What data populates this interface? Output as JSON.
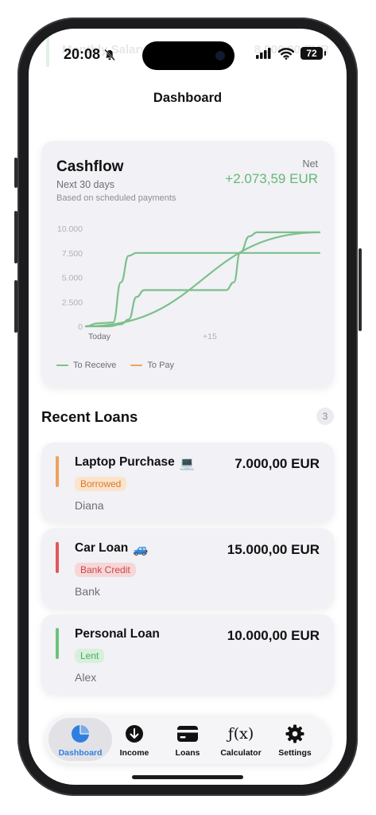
{
  "status_bar": {
    "time": "20:08",
    "battery": "72"
  },
  "ghost_header": {
    "label": "Monthly Salary",
    "amount": "8.000,00 EUR"
  },
  "nav": {
    "title": "Dashboard"
  },
  "cashflow": {
    "title": "Cashflow",
    "subtitle": "Next 30 days",
    "note": "Based on scheduled payments",
    "net_label": "Net",
    "net_value": "+2.073,59 EUR",
    "legend": {
      "receive": "To Receive",
      "pay": "To Pay"
    }
  },
  "chart_data": {
    "type": "line",
    "y_ticks": [
      "10.000",
      "7.500",
      "5.000",
      "2.500",
      "0"
    ],
    "x_ticks": [
      "Today",
      "+15"
    ],
    "ylim": [
      0,
      10000
    ],
    "xlim": [
      0,
      30
    ],
    "series": [
      {
        "name": "To Receive",
        "color": "#7cc08a",
        "x": [
          0,
          1.5,
          2.5,
          3.5,
          4.5,
          5.5,
          6.5,
          8,
          30
        ],
        "y": [
          0,
          300,
          350,
          400,
          4500,
          7200,
          7500,
          7500,
          7500
        ]
      },
      {
        "name": "To Receive",
        "color": "#7cc08a",
        "x": [
          0,
          3,
          4.5,
          5.5,
          6.5,
          7.5,
          15,
          18,
          19,
          19.8,
          21,
          22,
          23,
          30
        ],
        "y": [
          0,
          0,
          200,
          700,
          3000,
          3700,
          3700,
          3700,
          4500,
          7500,
          9200,
          9600,
          9600,
          9600
        ]
      },
      {
        "name": "To Receive",
        "color": "#7cc08a",
        "x": [
          0,
          30
        ],
        "y": [
          0,
          9600
        ]
      }
    ]
  },
  "recent_loans": {
    "title": "Recent Loans",
    "count": "3",
    "items": [
      {
        "name": "Laptop Purchase",
        "emoji": "💻",
        "amount": "7.000,00 EUR",
        "badge": "Borrowed",
        "person": "Diana",
        "color": "#f0a15a",
        "badge_bg": "#fbe3cc",
        "badge_fg": "#d9792b"
      },
      {
        "name": "Car Loan",
        "emoji": "🚙",
        "amount": "15.000,00 EUR",
        "badge": "Bank Credit",
        "person": "Bank",
        "color": "#e0575a",
        "badge_bg": "#f7d6d7",
        "badge_fg": "#c9474a"
      },
      {
        "name": "Personal Loan",
        "emoji": "",
        "amount": "10.000,00 EUR",
        "badge": "Lent",
        "person": "Alex",
        "color": "#6cc27c",
        "badge_bg": "#d7f0db",
        "badge_fg": "#4fa862"
      }
    ]
  },
  "tabbar": {
    "dashboard": "Dashboard",
    "income": "Income",
    "loans": "Loans",
    "calculator": "Calculator",
    "calculator_glyph": "ƒ(x)",
    "settings": "Settings"
  },
  "colors": {
    "accent": "#2f7fe0",
    "receive": "#7cc08a",
    "pay": "#f0a15a"
  }
}
